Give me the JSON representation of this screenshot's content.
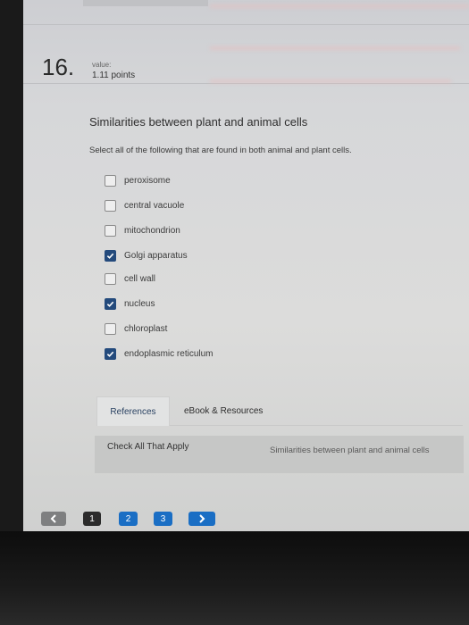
{
  "question": {
    "number": "16.",
    "value_label": "value:",
    "points": "1.11 points",
    "title": "Similarities between plant and animal cells",
    "prompt": "Select all of the following that are found in both animal and plant cells.",
    "options": [
      {
        "label": "peroxisome",
        "checked": false
      },
      {
        "label": "central vacuole",
        "checked": false
      },
      {
        "label": "mitochondrion",
        "checked": false
      },
      {
        "label": "Golgi apparatus",
        "checked": true
      },
      {
        "label": "cell wall",
        "checked": false
      },
      {
        "label": "nucleus",
        "checked": true
      },
      {
        "label": "chloroplast",
        "checked": false
      },
      {
        "label": "endoplasmic reticulum",
        "checked": true
      }
    ]
  },
  "tabs": [
    {
      "label": "References",
      "active": true
    },
    {
      "label": "eBook & Resources",
      "active": false
    }
  ],
  "info": {
    "type": "Check All That Apply",
    "topic": "Similarities between plant and animal cells"
  },
  "pagination": {
    "prev_icon": "chevron-left",
    "pages": [
      "1",
      "2",
      "3"
    ],
    "current": "1",
    "next_icon": "chevron-right"
  },
  "colors": {
    "checkbox_checked": "#234a7c",
    "page_button": "#1a6ec4",
    "current_page": "#2b2b2b"
  }
}
